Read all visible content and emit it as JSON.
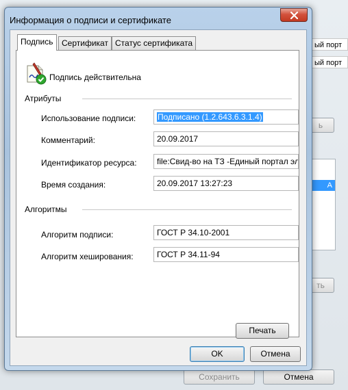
{
  "dialog": {
    "title": "Информация о подписи и сертификате",
    "tabs": [
      {
        "label": "Подпись",
        "active": true
      },
      {
        "label": "Сертификат",
        "active": false
      },
      {
        "label": "Статус сертификата",
        "active": false
      }
    ],
    "status": {
      "icon": "signature-valid-icon",
      "text": "Подпись действительна"
    },
    "attributes": {
      "title": "Атрибуты",
      "usage": {
        "label": "Использование подписи:",
        "value": "Подписано (1.2.643.6.3.1.4)"
      },
      "comment": {
        "label": "Комментарий:",
        "value": "20.09.2017"
      },
      "resource_id": {
        "label": "Идентификатор ресурса:",
        "value": "file:Свид-во на ТЗ -Единый портал эле"
      },
      "created": {
        "label": "Время создания:",
        "value": "20.09.2017 13:27:23"
      }
    },
    "algorithms": {
      "title": "Алгоритмы",
      "signature": {
        "label": "Алгоритм подписи:",
        "value": "ГОСТ Р 34.10-2001"
      },
      "hash": {
        "label": "Алгоритм хеширования:",
        "value": "ГОСТ Р 34.11-94"
      }
    },
    "print_label": "Печать",
    "ok_label": "OK",
    "cancel_label": "Отмена"
  },
  "background": {
    "list_items": [
      "ый порт",
      "ый порт"
    ],
    "tab_fragment": "А",
    "buttons": {
      "partial_1": "ь",
      "partial_2": "ть",
      "save": "Сохранить",
      "cancel": "Отмена"
    }
  }
}
